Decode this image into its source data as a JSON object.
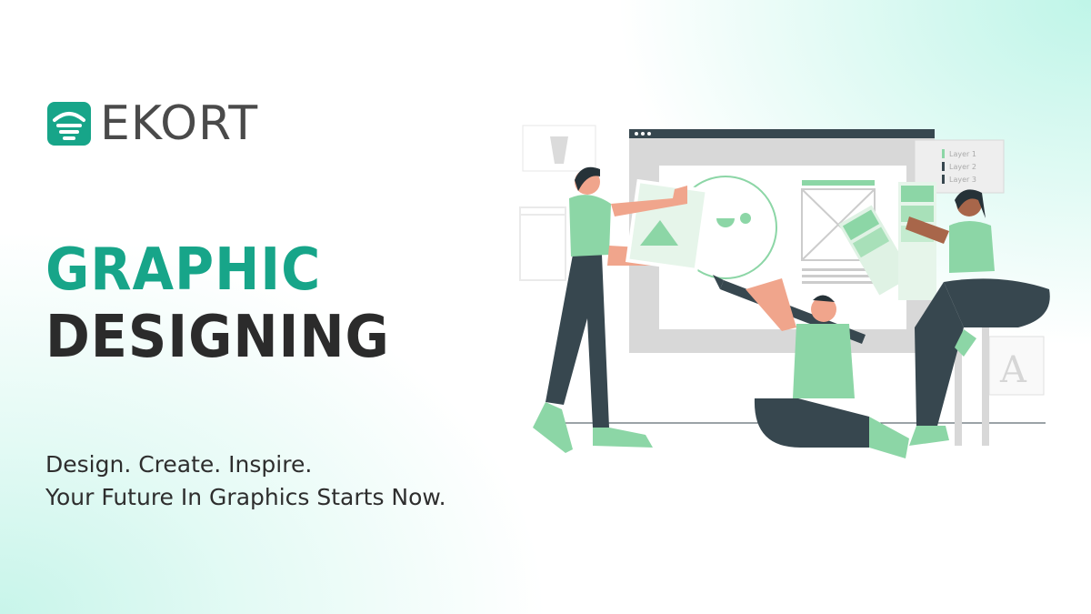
{
  "brand": {
    "name": "EKORT",
    "accent_color": "#17a589",
    "logo_icon": "wifi-signal-logo-icon"
  },
  "headline": {
    "line1": "GRAPHIC",
    "line2": "DESIGNING"
  },
  "tagline": {
    "line1": "Design. Create. Inspire.",
    "line2": "Your Future In Graphics Starts Now."
  },
  "illustration": {
    "layers_panel": [
      "Layer 1",
      "Layer 2",
      "Layer 3"
    ],
    "specimen_letter": "A"
  },
  "colors": {
    "green": "#8cd6a6",
    "dark": "#37474f",
    "skin": "#f0a58c",
    "frame": "#d0d0d0"
  }
}
